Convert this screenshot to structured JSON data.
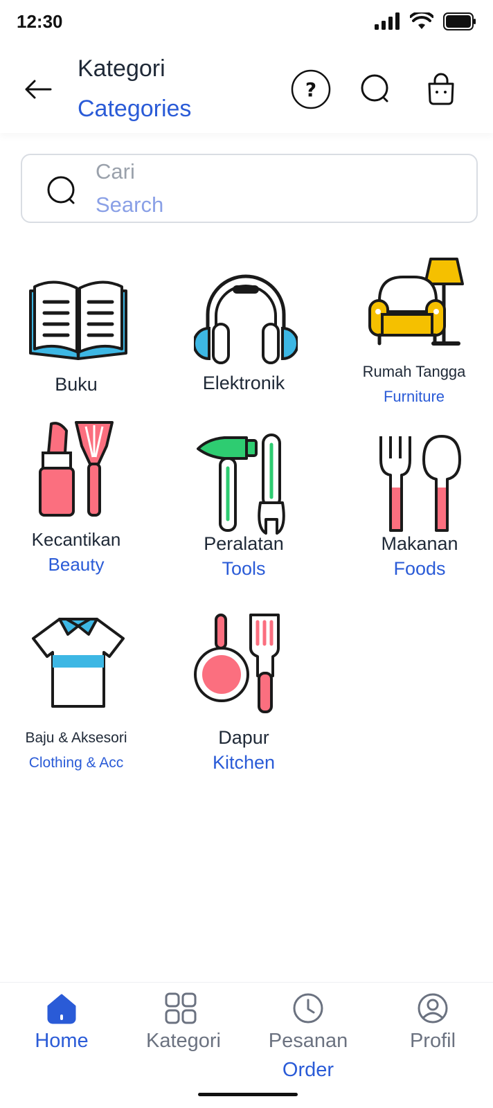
{
  "status_bar": {
    "time": "12:30"
  },
  "header": {
    "title": "Kategori",
    "subtitle": "Categories"
  },
  "search": {
    "placeholder_primary": "Cari",
    "placeholder_secondary": "Search"
  },
  "categories": [
    {
      "label": "Buku",
      "sublabel": "",
      "icon": "book-icon"
    },
    {
      "label": "Elektronik",
      "sublabel": "",
      "icon": "headphones-icon"
    },
    {
      "label": "Rumah Tangga",
      "sublabel": "Furniture",
      "icon": "sofa-lamp-icon"
    },
    {
      "label": "Kecantikan",
      "sublabel": "Beauty",
      "icon": "lipstick-brush-icon"
    },
    {
      "label": "Peralatan",
      "sublabel": "Tools",
      "icon": "hammer-wrench-icon"
    },
    {
      "label": "Makanan",
      "sublabel": "Foods",
      "icon": "fork-spoon-icon"
    },
    {
      "label": "Baju & Aksesori",
      "sublabel": "Clothing & Acc",
      "icon": "shirt-icon"
    },
    {
      "label": "Dapur",
      "sublabel": "Kitchen",
      "icon": "pan-spatula-icon"
    }
  ],
  "bottom_nav": {
    "items": [
      {
        "label": "Home",
        "sublabel": "",
        "icon": "home-icon",
        "active": true
      },
      {
        "label": "Kategori",
        "sublabel": "",
        "icon": "grid-icon",
        "active": false
      },
      {
        "label": "Pesanan",
        "sublabel": "Order",
        "icon": "clock-icon",
        "active": false
      },
      {
        "label": "Profil",
        "sublabel": "",
        "icon": "user-circle-icon",
        "active": false
      }
    ]
  },
  "colors": {
    "accent_blue": "#2a5bd7",
    "icon_blue": "#3db7e4",
    "icon_yellow": "#f5c000",
    "icon_pink": "#fb6f7f",
    "icon_green": "#2ecc71",
    "text_dark": "#1f2937",
    "nav_inactive": "#6b7280"
  }
}
